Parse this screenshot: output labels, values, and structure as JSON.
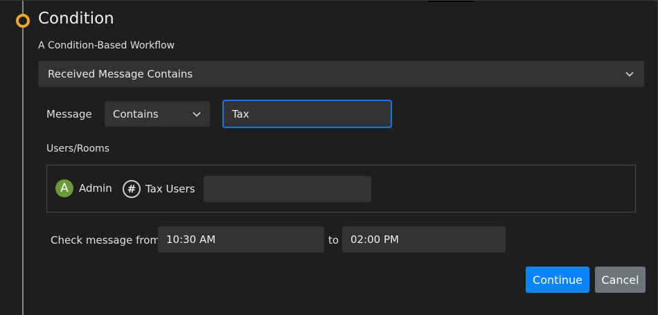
{
  "section": {
    "title": "Condition",
    "subtitle": "A Condition-Based Workflow"
  },
  "workflow_select": {
    "value": "Received Message Contains",
    "icon": "chevron-down-icon"
  },
  "message_row": {
    "label": "Message",
    "operator_value": "Contains",
    "text_value": "Tax"
  },
  "users_rooms": {
    "label": "Users/Rooms",
    "entries": [
      {
        "avatar": "A",
        "name": "Admin",
        "type": "user",
        "avatar_color": "#6a9a3a"
      },
      {
        "avatar": "#",
        "name": "Tax Users",
        "type": "room"
      }
    ],
    "input_value": ""
  },
  "time_row": {
    "label": "Check message from",
    "from": "10:30 AM",
    "separator": "to",
    "to": "02:00 PM"
  },
  "buttons": {
    "continue": "Continue",
    "cancel": "Cancel"
  },
  "colors": {
    "accent": "#f5a623",
    "primary": "#0a84ff",
    "secondary": "#6c757d",
    "focus_border": "#1b74e4"
  }
}
